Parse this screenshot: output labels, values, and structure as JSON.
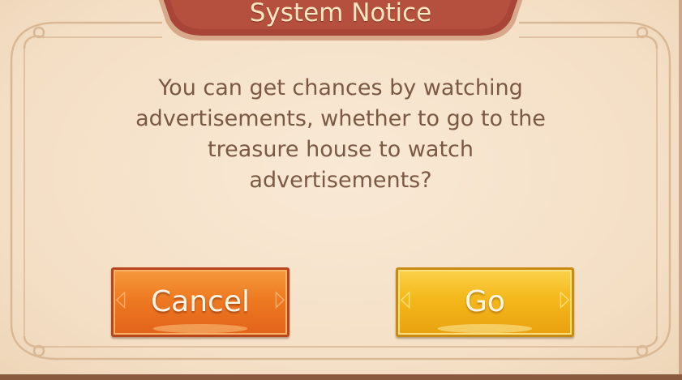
{
  "dialog": {
    "title": "System Notice",
    "message_lines": [
      "You can get chances by watching",
      "advertisements,  whether to go to the",
      "treasure house to watch",
      "advertisements?"
    ]
  },
  "buttons": {
    "cancel_label": "Cancel",
    "go_label": "Go"
  },
  "colors": {
    "background": "#f6e3cc",
    "title_banner": "#a84538",
    "text": "#7a5a44",
    "cancel_button": "#ee7a22",
    "go_button": "#f4b81a"
  }
}
